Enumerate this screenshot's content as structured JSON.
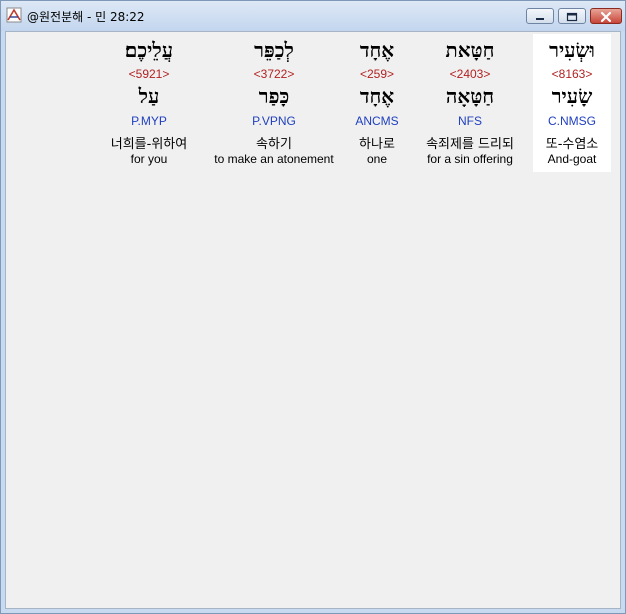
{
  "window": {
    "title": "@원전분해 - 민 28:22"
  },
  "words": [
    {
      "hebrew": "וּשְׂעִיר",
      "strong": "<8163>",
      "lemma": "שָׂעִיר",
      "morph": "C.NMSG",
      "korean": "또-수염소",
      "english": "And-goat"
    },
    {
      "hebrew": "חַטָּאת",
      "strong": "<2403>",
      "lemma": "חַטָּאָה",
      "morph": "NFS",
      "korean": "속죄제를 드리되",
      "english": "for a sin offering"
    },
    {
      "hebrew": "אֶחָד",
      "strong": "<259>",
      "lemma": "אֶחָד",
      "morph": "ANCMS",
      "korean": "하나로",
      "english": "one"
    },
    {
      "hebrew": "לְכַפֵּר",
      "strong": "<3722>",
      "lemma": "כָּפַר",
      "morph": "P.VPNG",
      "korean": "속하기",
      "english": "to make an atonement"
    },
    {
      "hebrew": "עֲלֵיכֶם׃",
      "strong": "<5921>",
      "lemma": "עַל",
      "morph": "P.MYP",
      "korean": "너희를-위하여",
      "english": "for you"
    }
  ]
}
